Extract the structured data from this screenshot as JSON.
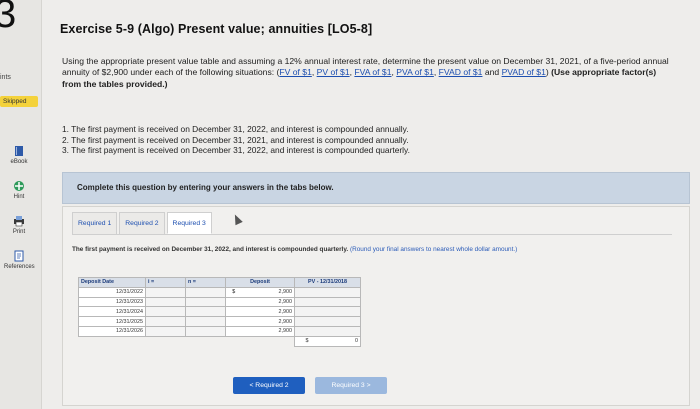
{
  "question": {
    "number": "3",
    "points_label": "ints",
    "status": "Skipped"
  },
  "side_tools": [
    {
      "label": "eBook",
      "icon": "book-icon"
    },
    {
      "label": "Hint",
      "icon": "hint-icon"
    },
    {
      "label": "Print",
      "icon": "print-icon"
    },
    {
      "label": "References",
      "icon": "references-icon"
    }
  ],
  "title": "Exercise 5-9 (Algo) Present value; annuities [LO5-8]",
  "intro": {
    "text1": "Using the appropriate present value table and assuming a 12% annual interest rate, determine the present value on December 31, 2021, of a five-period annual annuity of $2,900 under each of the following situations: (",
    "links": [
      "FV of $1",
      "PV of $1",
      "FVA of $1",
      "PVA of $1",
      "FVAD of $1",
      "PVAD of $1"
    ],
    "text2": ") ",
    "bold": "(Use appropriate factor(s) from the tables provided.)"
  },
  "situations": [
    "1. The first payment is received on December 31, 2022, and interest is compounded annually.",
    "2. The first payment is received on December 31, 2021, and interest is compounded annually.",
    "3. The first payment is received on December 31, 2022, and interest is compounded quarterly."
  ],
  "banner": "Complete this question by entering your answers in the tabs below.",
  "tabs": [
    "Required 1",
    "Required 2",
    "Required 3"
  ],
  "active_tab_index": 2,
  "subquestion": {
    "text": "The first payment is received on December 31, 2022, and interest is compounded quarterly.",
    "note": "(Round your final answers to nearest whole dollar amount.)"
  },
  "table": {
    "headers": {
      "date": "Deposit Date",
      "i": "i =",
      "n": "n =",
      "deposit": "Deposit",
      "pv": "PV - 12/31/2018"
    },
    "rows": [
      {
        "date": "12/31/2022",
        "currency": "$",
        "deposit": "2,900"
      },
      {
        "date": "12/31/2023",
        "currency": "",
        "deposit": "2,900"
      },
      {
        "date": "12/31/2024",
        "currency": "",
        "deposit": "2,900"
      },
      {
        "date": "12/31/2025",
        "currency": "",
        "deposit": "2,900"
      },
      {
        "date": "12/31/2026",
        "currency": "",
        "deposit": "2,900"
      }
    ],
    "total": {
      "currency": "$",
      "value": "0"
    }
  },
  "buttons": {
    "prev": "< Required 2",
    "next": "Required 3 >"
  },
  "colors": {
    "accent": "#1f5fbf",
    "banner": "#c9d5e3",
    "skipped": "#f4d23b"
  }
}
